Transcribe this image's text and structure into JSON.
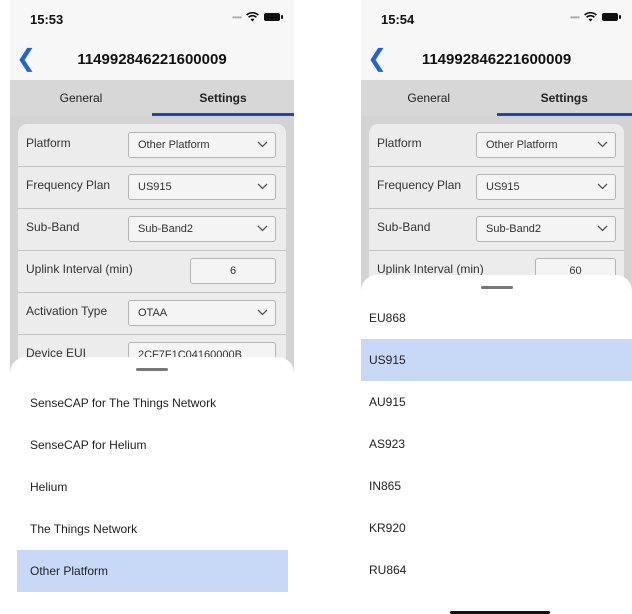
{
  "left": {
    "time": "15:53",
    "title": "114992846221600009",
    "tabs": [
      "General",
      "Settings"
    ],
    "fields": {
      "platform": {
        "label": "Platform",
        "value": "Other Platform"
      },
      "frequency_plan": {
        "label": "Frequency Plan",
        "value": "US915"
      },
      "sub_band": {
        "label": "Sub-Band",
        "value": "Sub-Band2"
      },
      "uplink_interval": {
        "label": "Uplink Interval (min)",
        "value": "6"
      },
      "activation_type": {
        "label": "Activation Type",
        "value": "OTAA"
      },
      "device_eui": {
        "label": "Device EUI",
        "value": "2CF7F1C04160000B"
      }
    },
    "sheet_options": [
      "SenseCAP for The Things Network",
      "SenseCAP for Helium",
      "Helium",
      "The Things Network",
      "Other Platform"
    ],
    "selected_option": "Other Platform"
  },
  "right": {
    "time": "15:54",
    "title": "114992846221600009",
    "tabs": [
      "General",
      "Settings"
    ],
    "fields": {
      "platform": {
        "label": "Platform",
        "value": "Other Platform"
      },
      "frequency_plan": {
        "label": "Frequency Plan",
        "value": "US915"
      },
      "sub_band": {
        "label": "Sub-Band",
        "value": "Sub-Band2"
      },
      "uplink_interval": {
        "label": "Uplink Interval (min)",
        "value": "60"
      }
    },
    "sheet_options": [
      "EU868",
      "US915",
      "AU915",
      "AS923",
      "IN865",
      "KR920",
      "RU864"
    ],
    "selected_option": "US915"
  },
  "colors": {
    "accent": "#1f64d6",
    "tab_indicator": "#1c4aa6",
    "selected_row": "#c7d9f7"
  },
  "icons": [
    "wifi-icon",
    "battery-icon",
    "back-chevron-icon",
    "chevron-down-icon"
  ]
}
